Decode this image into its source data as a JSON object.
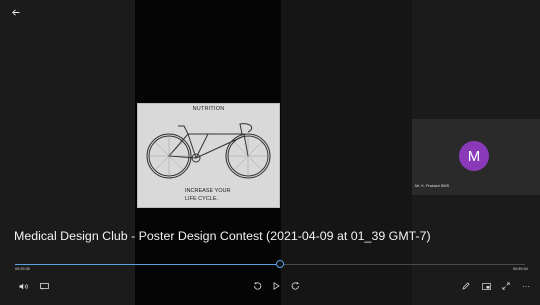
{
  "poster": {
    "title": "NUTRITION",
    "subtitle_line1": "INCREASE YOUR",
    "subtitle_line2": "LIFE CYCLE."
  },
  "participant": {
    "initial": "M",
    "name": "Mr. K. Prakash BMS",
    "avatar_color": "#8a3ab9"
  },
  "video": {
    "title": "Medical Design Club - Poster Design Contest (2021-04-09 at 01_39 GMT-7)"
  },
  "playback": {
    "elapsed": "00:29:35",
    "duration": "00:59:34",
    "progress_percent": 52,
    "accent_color": "#5aa0e8"
  },
  "controls": {
    "more_label": "···"
  }
}
